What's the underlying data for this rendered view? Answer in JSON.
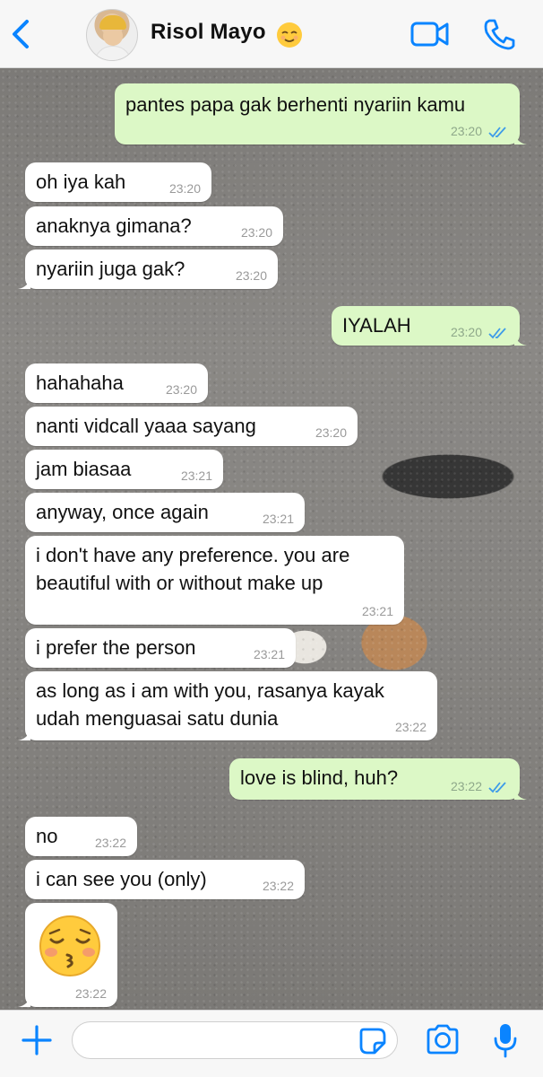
{
  "header": {
    "contact_name": "Risol Mayo",
    "contact_emoji": "😌",
    "accent_color": "#0a84ff"
  },
  "messages": [
    {
      "direction": "out",
      "text": "pantes papa gak berhenti nyariin kamu",
      "time": "23:20",
      "read": true
    },
    {
      "direction": "in",
      "text": "oh iya kah",
      "time": "23:20"
    },
    {
      "direction": "in",
      "text": "anaknya gimana?",
      "time": "23:20"
    },
    {
      "direction": "in",
      "text": "nyariin juga gak?",
      "time": "23:20"
    },
    {
      "direction": "out",
      "text": "IYALAH",
      "time": "23:20",
      "read": true
    },
    {
      "direction": "in",
      "text": "hahahaha",
      "time": "23:20"
    },
    {
      "direction": "in",
      "text": "nanti vidcall yaaa sayang",
      "time": "23:20"
    },
    {
      "direction": "in",
      "text": "jam biasaa",
      "time": "23:21"
    },
    {
      "direction": "in",
      "text": "anyway, once again",
      "time": "23:21"
    },
    {
      "direction": "in",
      "text": "i don't have any preference. you are beautiful with or without make up",
      "time": "23:21"
    },
    {
      "direction": "in",
      "text": "i prefer the person",
      "time": "23:21"
    },
    {
      "direction": "in",
      "text": "as long as i am with you, rasanya kayak udah menguasai satu dunia",
      "time": "23:22"
    },
    {
      "direction": "out",
      "text": "love is blind, huh?",
      "time": "23:22",
      "read": true
    },
    {
      "direction": "in",
      "text": "no",
      "time": "23:22"
    },
    {
      "direction": "in",
      "text": "i can see you (only)",
      "time": "23:22"
    },
    {
      "direction": "in",
      "text": "😚",
      "time": "23:22",
      "emoji_only": true
    }
  ],
  "input": {
    "placeholder": "",
    "value": ""
  },
  "icons": {
    "back": "chevron-left-icon",
    "video": "video-camera-icon",
    "call": "phone-icon",
    "plus": "plus-icon",
    "sticker": "sticker-icon",
    "camera": "camera-icon",
    "mic": "microphone-icon"
  }
}
